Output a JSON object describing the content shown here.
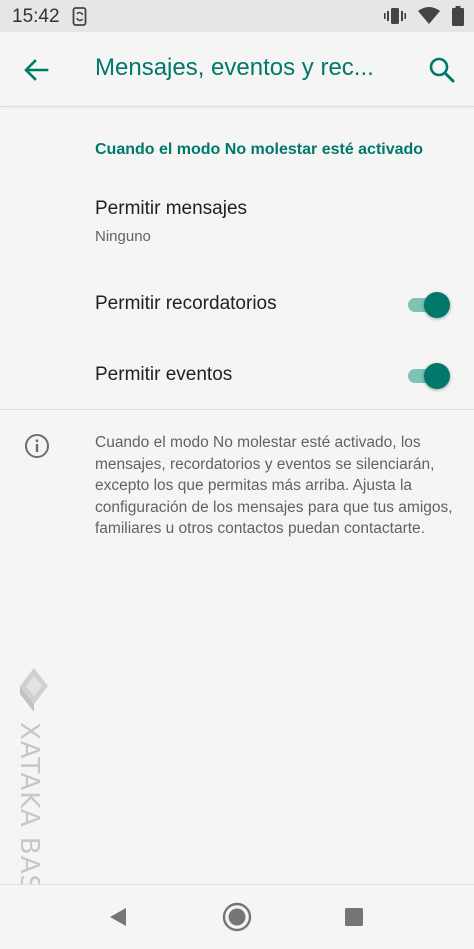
{
  "status_bar": {
    "time": "15:42"
  },
  "app_bar": {
    "title": "Mensajes, eventos y rec..."
  },
  "section": {
    "header": "Cuando el modo No molestar esté activado"
  },
  "settings": {
    "messages": {
      "title": "Permitir mensajes",
      "value": "Ninguno"
    },
    "reminders": {
      "title": "Permitir recordatorios",
      "enabled": true
    },
    "events": {
      "title": "Permitir eventos",
      "enabled": true
    }
  },
  "info": {
    "text": "Cuando el modo No molestar esté activado, los mensajes, recordatorios y eventos se silenciarán, excepto los que permitas más arriba. Ajusta la configuración de los mensajes para que tus amigos, familiares u otros contactos puedan contactarte."
  },
  "watermark": {
    "text": "XATAKA BASICS"
  },
  "colors": {
    "accent": "#00796b",
    "toggle_track": "#7dc3b6",
    "background": "#f5f5f5"
  }
}
